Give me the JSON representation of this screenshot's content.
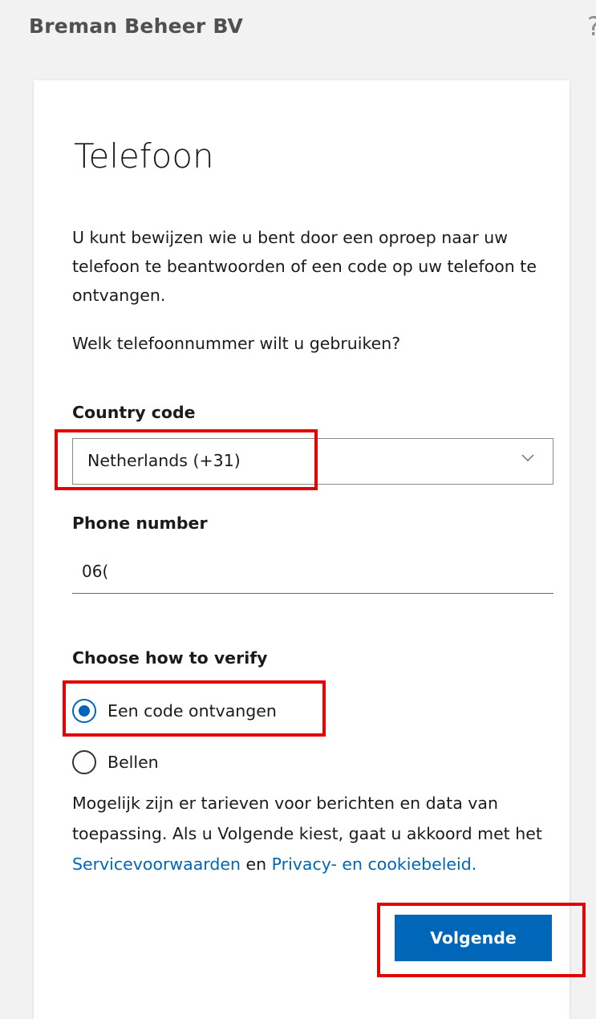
{
  "header": {
    "org_name": "Breman Beheer BV",
    "help_icon": "?"
  },
  "form": {
    "title": "Telefoon",
    "intro": "U kunt bewijzen wie u bent door een oproep naar uw telefoon te beantwoorden of een code op uw telefoon te ontvangen.",
    "question": "Welk telefoonnummer wilt u gebruiken?",
    "country_code_label": "Country code",
    "country_code_value": "Netherlands (+31)",
    "phone_number_label": "Phone number",
    "phone_number_value": "06(",
    "verify_label": "Choose how to verify",
    "verify_options": [
      {
        "label": "Een code ontvangen",
        "selected": true
      },
      {
        "label": "Bellen",
        "selected": false
      }
    ],
    "disclaimer_part1": "Mogelijk zijn er tarieven voor berichten en data van toepassing. Als u Volgende kiest, gaat u akkoord met het ",
    "terms_link": "Servicevoorwaarden",
    "disclaimer_and": " en ",
    "privacy_link": "Privacy- en cookiebeleid.",
    "next_button": "Volgende"
  },
  "icons": {
    "help": "question-mark-icon",
    "dropdown": "chevron-down-icon"
  },
  "colors": {
    "accent": "#0067b8",
    "highlight": "#e30000",
    "background": "#f2f2f2"
  }
}
